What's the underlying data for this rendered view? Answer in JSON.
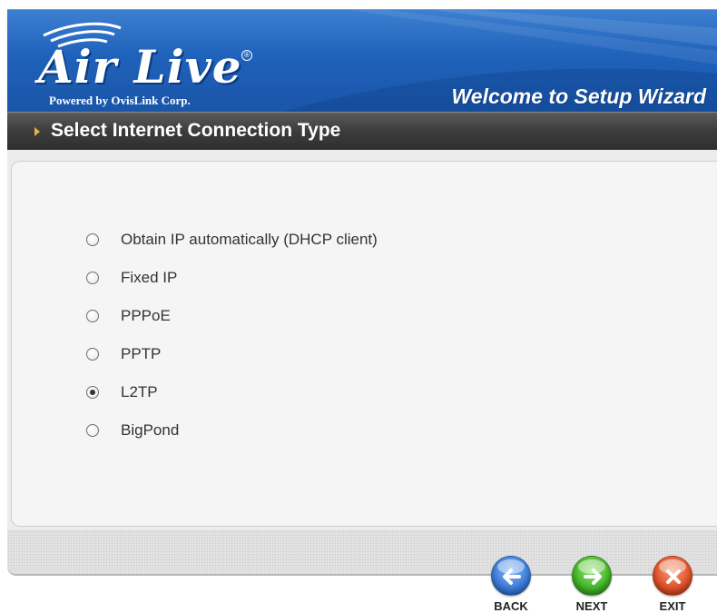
{
  "header": {
    "logo_text": "Air Live",
    "logo_registered": "®",
    "logo_subtitle": "Powered by OvisLink Corp.",
    "title": "Welcome to Setup Wizard"
  },
  "section": {
    "title": "Select Internet Connection Type"
  },
  "connection_types": {
    "selected": "L2TP",
    "options": [
      {
        "label": "Obtain IP automatically (DHCP client)",
        "checked": false
      },
      {
        "label": "Fixed IP",
        "checked": false
      },
      {
        "label": "PPPoE",
        "checked": false
      },
      {
        "label": "PPTP",
        "checked": false
      },
      {
        "label": "L2TP",
        "checked": true
      },
      {
        "label": "BigPond",
        "checked": false
      }
    ]
  },
  "nav": {
    "back_label": "BACK",
    "next_label": "NEXT",
    "exit_label": "EXIT"
  },
  "colors": {
    "banner_blue": "#1f62bb",
    "section_bar": "#3c3c3c",
    "section_arrow": "#e8b23a",
    "back_button": "#3f7fdc",
    "next_button": "#46b92a",
    "exit_button": "#e3552c"
  },
  "icons": {
    "back": "arrow-left-icon",
    "next": "arrow-right-icon",
    "exit": "close-x-icon"
  }
}
